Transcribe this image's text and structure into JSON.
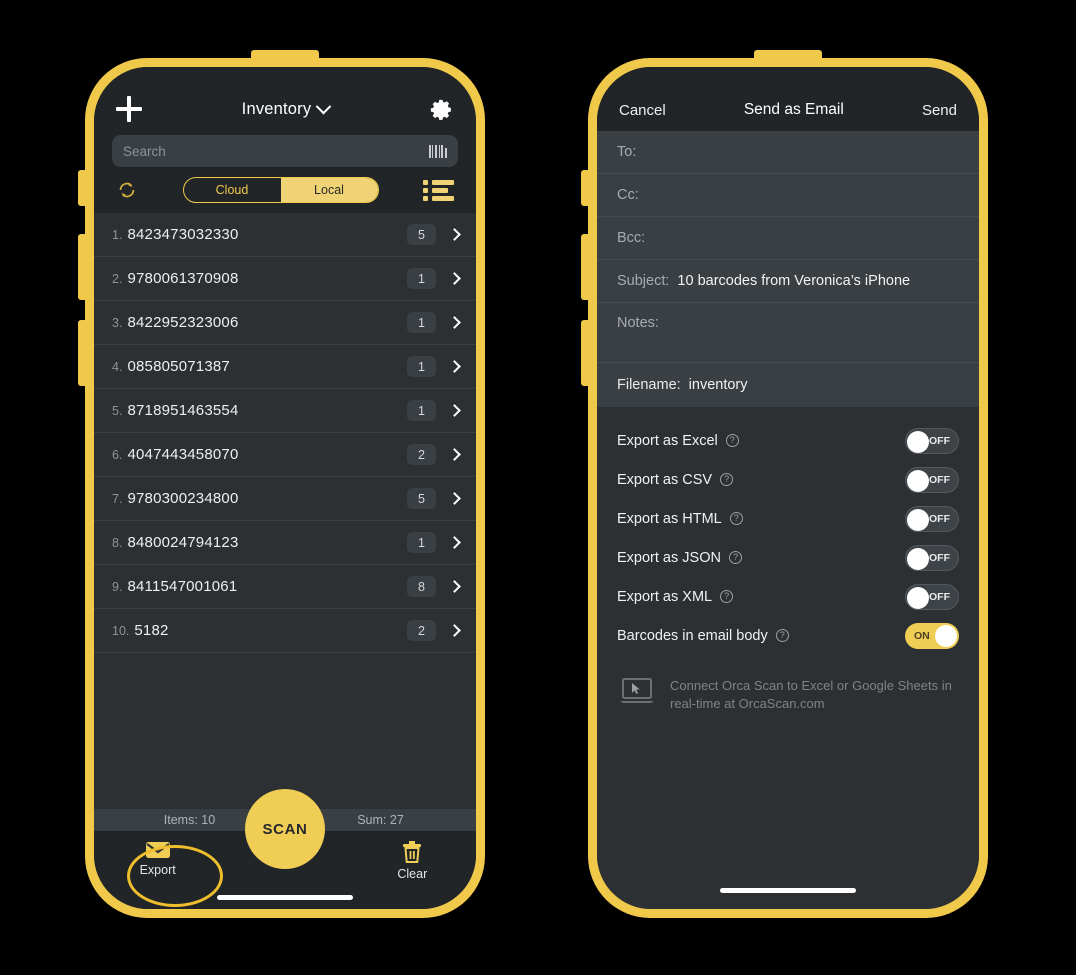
{
  "colors": {
    "frame_yellow": "#F0C94B",
    "accent_yellow": "#F0CE56",
    "screen_bg": "#2C3033",
    "bar_bg": "#212528",
    "field_bg": "#3A3F43",
    "text_primary": "#F0F2F4",
    "text_muted": "#8E9399"
  },
  "inventory_screen": {
    "add_icon": "plus-icon",
    "title": "Inventory",
    "title_chevron": "chevron-down-icon",
    "settings_icon": "gear-icon",
    "search": {
      "placeholder": "Search",
      "trailing_icon": "barcode-icon"
    },
    "sync_icon": "sync-icon",
    "segmented": {
      "options": [
        "Cloud",
        "Local"
      ],
      "selected": "Local"
    },
    "list_view_icon": "list-view-icon",
    "rows": [
      {
        "index": "1.",
        "code": "8423473032330",
        "qty": "5"
      },
      {
        "index": "2.",
        "code": "9780061370908",
        "qty": "1"
      },
      {
        "index": "3.",
        "code": "8422952323006",
        "qty": "1"
      },
      {
        "index": "4.",
        "code": "085805071387",
        "qty": "1"
      },
      {
        "index": "5.",
        "code": "8718951463554",
        "qty": "1"
      },
      {
        "index": "6.",
        "code": "4047443458070",
        "qty": "2"
      },
      {
        "index": "7.",
        "code": "9780300234800",
        "qty": "5"
      },
      {
        "index": "8.",
        "code": "8480024794123",
        "qty": "1"
      },
      {
        "index": "9.",
        "code": "8411547001061",
        "qty": "8"
      },
      {
        "index": "10.",
        "code": "5182",
        "qty": "2"
      }
    ],
    "totals": {
      "items": "Items: 10",
      "sum": "Sum: 27"
    },
    "tabbar": {
      "export_label": "Export",
      "export_icon": "envelope-icon",
      "scan_label": "SCAN",
      "clear_label": "Clear",
      "clear_icon": "trash-icon"
    }
  },
  "email_screen": {
    "nav": {
      "cancel": "Cancel",
      "title": "Send as Email",
      "send": "Send"
    },
    "fields": [
      {
        "label": "To:",
        "value": ""
      },
      {
        "label": "Cc:",
        "value": ""
      },
      {
        "label": "Bcc:",
        "value": ""
      },
      {
        "label": "Subject:",
        "value": "10 barcodes from Veronica’s iPhone"
      },
      {
        "label": "Notes:",
        "value": ""
      }
    ],
    "filename": {
      "label": "Filename:",
      "value": "inventory"
    },
    "toggles": [
      {
        "label": "Export as Excel",
        "state": "OFF",
        "on": false
      },
      {
        "label": "Export as CSV",
        "state": "OFF",
        "on": false
      },
      {
        "label": "Export as HTML",
        "state": "OFF",
        "on": false
      },
      {
        "label": "Export as JSON",
        "state": "OFF",
        "on": false
      },
      {
        "label": "Export as XML",
        "state": "OFF",
        "on": false
      },
      {
        "label": "Barcodes in email body",
        "state": "ON",
        "on": true
      }
    ],
    "help_icon": "question-mark-icon",
    "promo": {
      "icon": "laptop-icon",
      "text": "Connect Orca Scan to Excel or Google Sheets in real-time at OrcaScan.com"
    }
  }
}
